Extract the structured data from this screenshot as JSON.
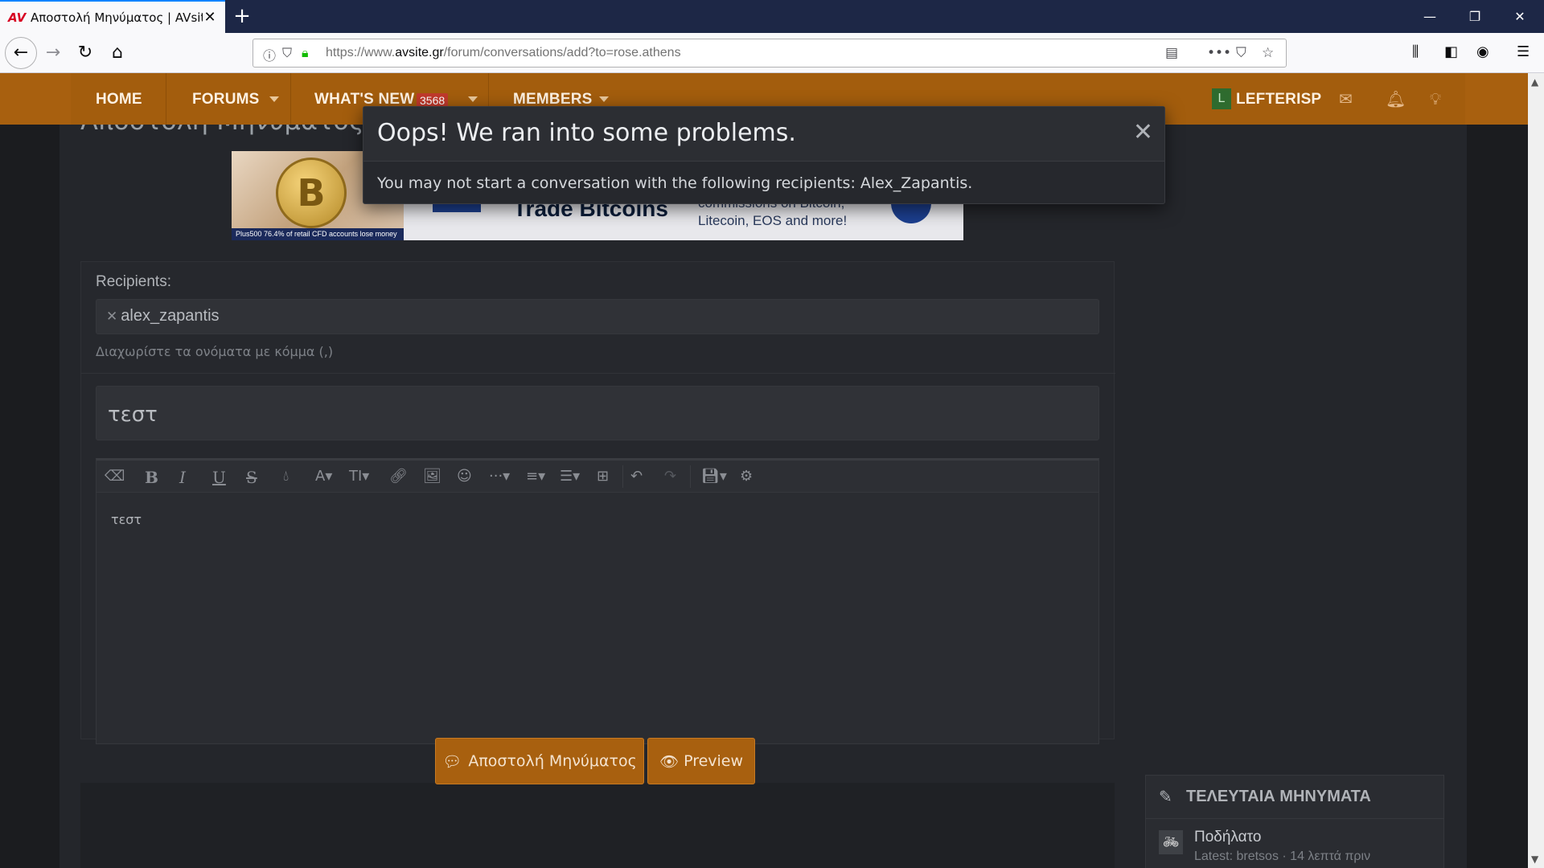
{
  "browser": {
    "tab_title": "Αποστολή Μηνύματος | AVsite",
    "tab_favicon": "AV",
    "url_prefix": "https://www.",
    "url_domain": "avsite.gr",
    "url_path": "/forum/conversations/add?to=rose.athens"
  },
  "forum_nav": {
    "home": "HOME",
    "forums": "FORUMS",
    "whats_new": "WHAT'S NEW",
    "whats_new_count": "3568",
    "members": "MEMBERS",
    "user_avatar_letter": "L",
    "username": "LEFTERISP"
  },
  "page": {
    "title": "Αποστολή Μηνύματος"
  },
  "ad": {
    "headline": "Trade Bitcoins",
    "copy_line1": "commissions on Bitcoin,",
    "copy_line2": "Litecoin, EOS and more!",
    "disclaimer": "Plus500 76.4% of retail CFD accounts lose money",
    "coin_symbol": "B"
  },
  "form": {
    "recipients_label": "Recipients:",
    "recipient_tag": "alex_zapantis",
    "recipients_hint": "Διαχωρίστε τα ονόματα με κόμμα (,)",
    "title_value": "τεστ",
    "editor_value": "τεστ"
  },
  "buttons": {
    "send": "Αποστολή Μηνύματος",
    "preview": "Preview"
  },
  "sidebar": {
    "widget_title": "ΤΕΛΕΥΤΑΙΑ ΜΗΝΥΜΑΤΑ",
    "item_title": "Ποδήλατο",
    "item_meta": "Latest: bretsos · 14 λεπτά πριν"
  },
  "modal": {
    "title": "Oops! We ran into some problems.",
    "message": "You may not start a conversation with the following recipients: Alex_Zapantis."
  },
  "colors": {
    "nav_orange": "#a35d0d",
    "button_orange": "#a8600f",
    "page_bg": "#1b1c1f",
    "panel_bg": "#26282d"
  }
}
